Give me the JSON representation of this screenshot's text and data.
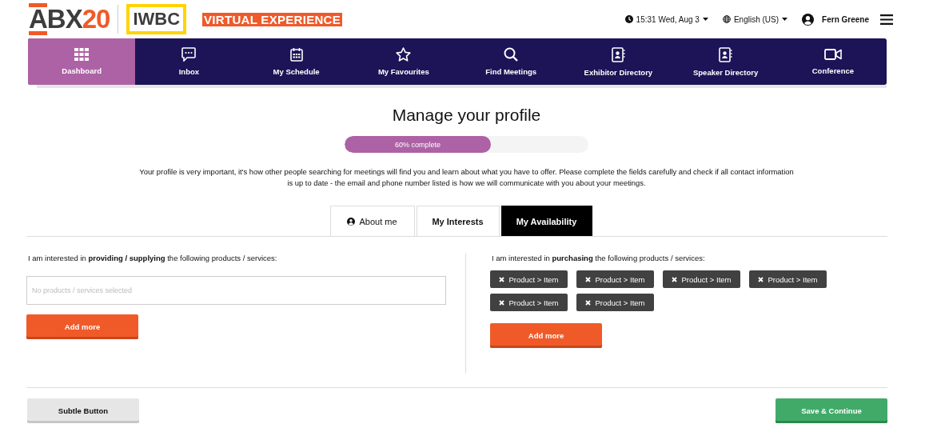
{
  "header": {
    "logo": {
      "brand": "ABX",
      "year": "20",
      "partner": "IWBC",
      "tagline": "VIRTUAL EXPERIENCE"
    },
    "clock": "15:31 Wed, Aug 3",
    "language": "English (US)",
    "user": "Fern Greene"
  },
  "nav": [
    {
      "label": "Dashboard",
      "kind": "grid",
      "selected": true
    },
    {
      "label": "Inbox",
      "kind": "chat",
      "selected": false
    },
    {
      "label": "My Schedule",
      "kind": "calendar",
      "selected": false
    },
    {
      "label": "My Favourites",
      "kind": "star",
      "selected": false
    },
    {
      "label": "Find Meetings",
      "kind": "search",
      "selected": false
    },
    {
      "label": "Exhibitor Directory",
      "kind": "contacts",
      "selected": false
    },
    {
      "label": "Speaker Directory",
      "kind": "contacts",
      "selected": false
    },
    {
      "label": "Conference",
      "kind": "video",
      "selected": false
    }
  ],
  "title": "Manage your profile",
  "progress": {
    "label": "60% complete",
    "level": 0.6
  },
  "intro": "Your profile is very important, it's how other people searching for meetings will find you and learn about what you have to offer. Please complete the fields carefully and check if all contact information is up to date - the email and phone number listed is how we will communicate with you about your meetings.",
  "tabs": [
    {
      "label": "About me",
      "kind": "user",
      "selected": false
    },
    {
      "label": "My Interests",
      "kind": "plain",
      "selected": false
    },
    {
      "label": "My Availability",
      "kind": "plain",
      "selected": true
    }
  ],
  "sections": [
    {
      "heading": "I am interested in **providing / supplying** the following products / services:",
      "placeholder": "No products / services selected",
      "button": "Add more"
    },
    {
      "heading": "I am interested in **purchasing** the following products / services:",
      "tags": [
        "Product > Item",
        "Product > Item",
        "Product > Item",
        "Product > Item",
        "Product > Item",
        "Product > Item"
      ],
      "button": "Add more"
    }
  ],
  "footer": {
    "secondary": "Subtle Button",
    "primary": "Save & Continue"
  }
}
